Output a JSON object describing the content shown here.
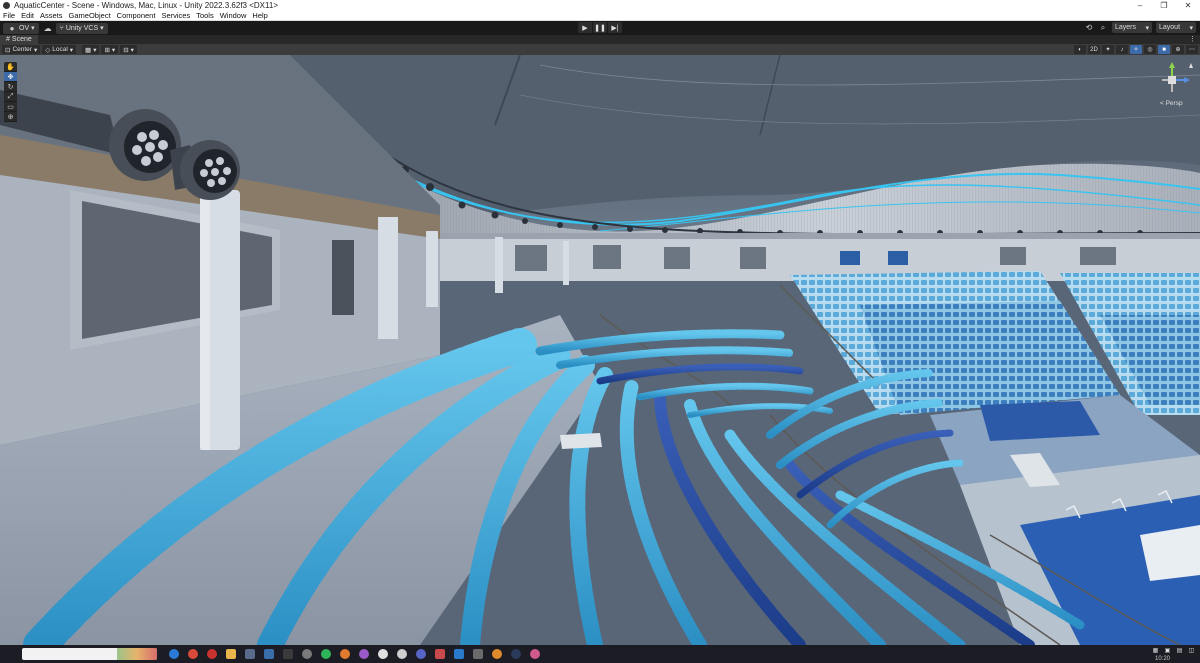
{
  "window": {
    "title": "AquaticCenter - Scene - Windows, Mac, Linux - Unity 2022.3.62f3 <DX11>",
    "minimize": "–",
    "maximize": "❐",
    "close": "✕"
  },
  "menu": [
    "File",
    "Edit",
    "Assets",
    "GameObject",
    "Component",
    "Services",
    "Tools",
    "Window",
    "Help"
  ],
  "toolbar": {
    "account_label": "OV",
    "vcs_label": "Unity VCS",
    "layers_label": "Layers",
    "layout_label": "Layout"
  },
  "scene_tab": {
    "label": "Scene",
    "menu_glyph": "⋮"
  },
  "scene_toolbar": {
    "pivot_label": "Center",
    "space_label": "Local",
    "mode_2d_label": "2D"
  },
  "gizmo": {
    "projection_label": "< Persp"
  },
  "taskbar": {
    "clock": "10:20"
  },
  "colors": {
    "seat_light": "#4fb3e0",
    "seat_mid": "#2e8fc4",
    "seat_dark": "#1d4fa0",
    "accent_blue": "#3d6aa8",
    "ceiling_stripe": "#38c4f0"
  }
}
